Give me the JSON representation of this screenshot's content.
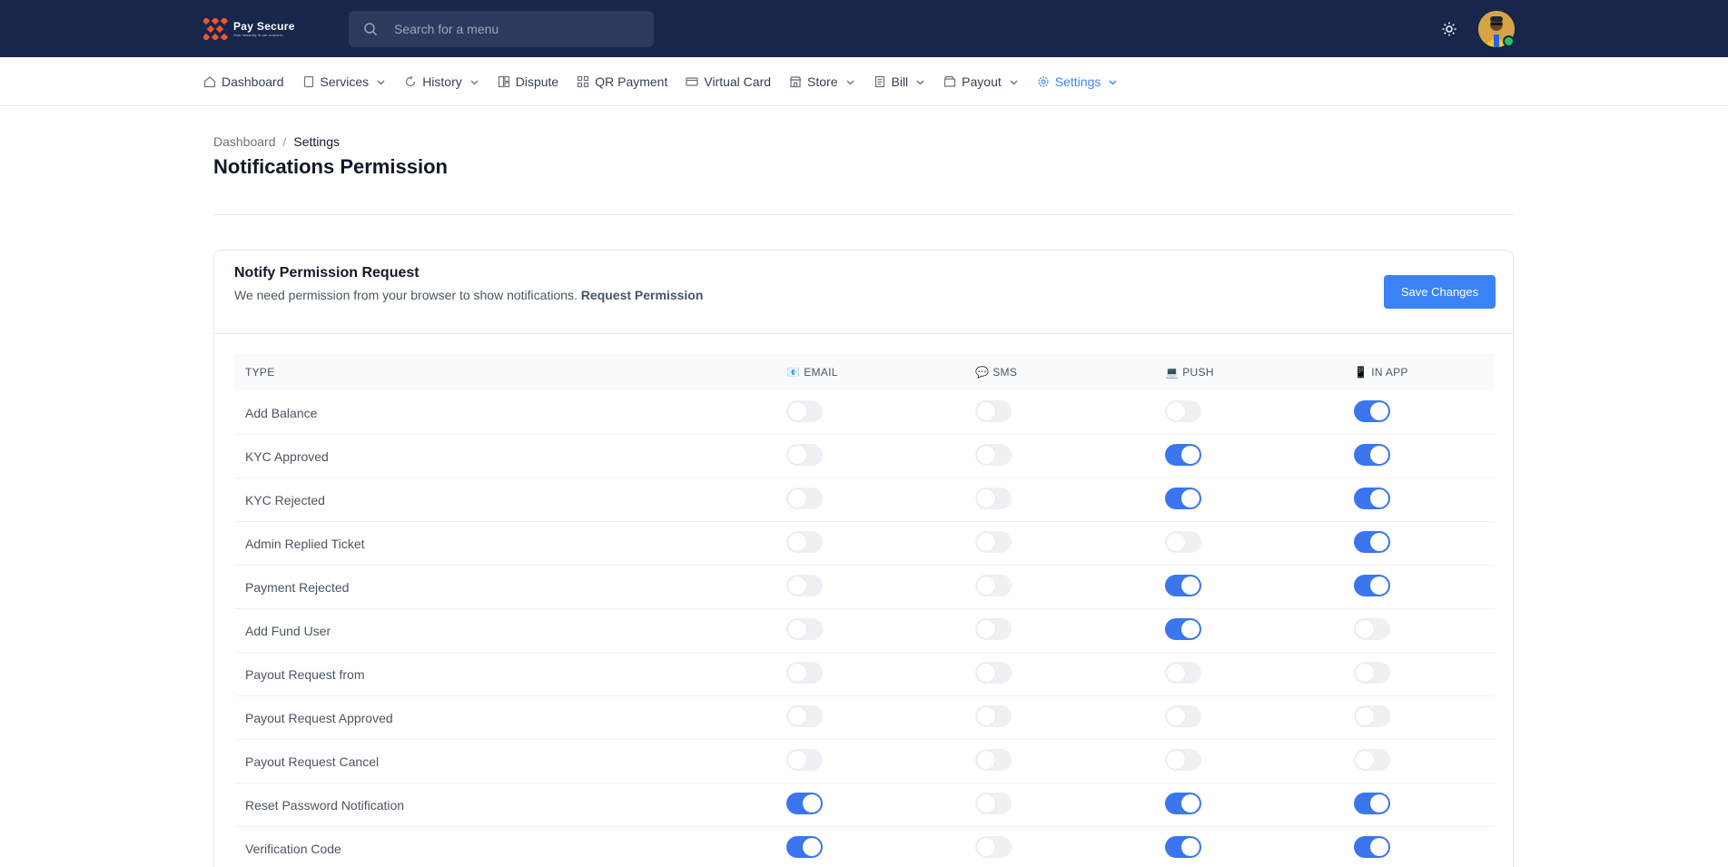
{
  "app": {
    "logo_title": "Pay Secure",
    "logo_subtitle": "Your security is our concern"
  },
  "search": {
    "placeholder": "Search for a menu"
  },
  "nav": [
    {
      "label": "Dashboard",
      "icon": "home-icon",
      "dropdown": false
    },
    {
      "label": "Services",
      "icon": "file-icon",
      "dropdown": true
    },
    {
      "label": "History",
      "icon": "refresh-icon",
      "dropdown": true
    },
    {
      "label": "Dispute",
      "icon": "layout-icon",
      "dropdown": false
    },
    {
      "label": "QR Payment",
      "icon": "qr-icon",
      "dropdown": false
    },
    {
      "label": "Virtual Card",
      "icon": "card-icon",
      "dropdown": false
    },
    {
      "label": "Store",
      "icon": "store-icon",
      "dropdown": true
    },
    {
      "label": "Bill",
      "icon": "bill-icon",
      "dropdown": true
    },
    {
      "label": "Payout",
      "icon": "wallet-icon",
      "dropdown": true
    },
    {
      "label": "Settings",
      "icon": "gear-icon",
      "dropdown": true,
      "active": true
    }
  ],
  "breadcrumb": {
    "home": "Dashboard",
    "separator": "/",
    "current": "Settings"
  },
  "page_title": "Notifications Permission",
  "card": {
    "title": "Notify Permission Request",
    "description": "We need permission from your browser to show notifications.",
    "link": "Request Permission",
    "save_label": "Save Changes"
  },
  "table": {
    "headers": {
      "type": "TYPE",
      "email": "EMAIL",
      "sms": "SMS",
      "push": "PUSH",
      "in_app": "IN APP"
    },
    "header_icons": {
      "email": "📧",
      "sms": "💬",
      "push": "💻",
      "in_app": "📱"
    },
    "rows": [
      {
        "type": "Add Balance",
        "email": false,
        "sms": false,
        "push": false,
        "in_app": true
      },
      {
        "type": "KYC Approved",
        "email": false,
        "sms": false,
        "push": true,
        "in_app": true
      },
      {
        "type": "KYC Rejected",
        "email": false,
        "sms": false,
        "push": true,
        "in_app": true
      },
      {
        "type": "Admin Replied Ticket",
        "email": false,
        "sms": false,
        "push": false,
        "in_app": true
      },
      {
        "type": "Payment Rejected",
        "email": false,
        "sms": false,
        "push": true,
        "in_app": true
      },
      {
        "type": "Add Fund User",
        "email": false,
        "sms": false,
        "push": true,
        "in_app": false
      },
      {
        "type": "Payout Request from",
        "email": false,
        "sms": false,
        "push": false,
        "in_app": false
      },
      {
        "type": "Payout Request Approved",
        "email": false,
        "sms": false,
        "push": false,
        "in_app": false
      },
      {
        "type": "Payout Request Cancel",
        "email": false,
        "sms": false,
        "push": false,
        "in_app": false
      },
      {
        "type": "Reset Password Notification",
        "email": true,
        "sms": false,
        "push": true,
        "in_app": true
      },
      {
        "type": "Verification Code",
        "email": true,
        "sms": false,
        "push": true,
        "in_app": true
      }
    ]
  },
  "colors": {
    "topbar": "#17264a",
    "accent": "#3b82f6",
    "logo_orange": "#f0542d",
    "online": "#22c55e"
  }
}
